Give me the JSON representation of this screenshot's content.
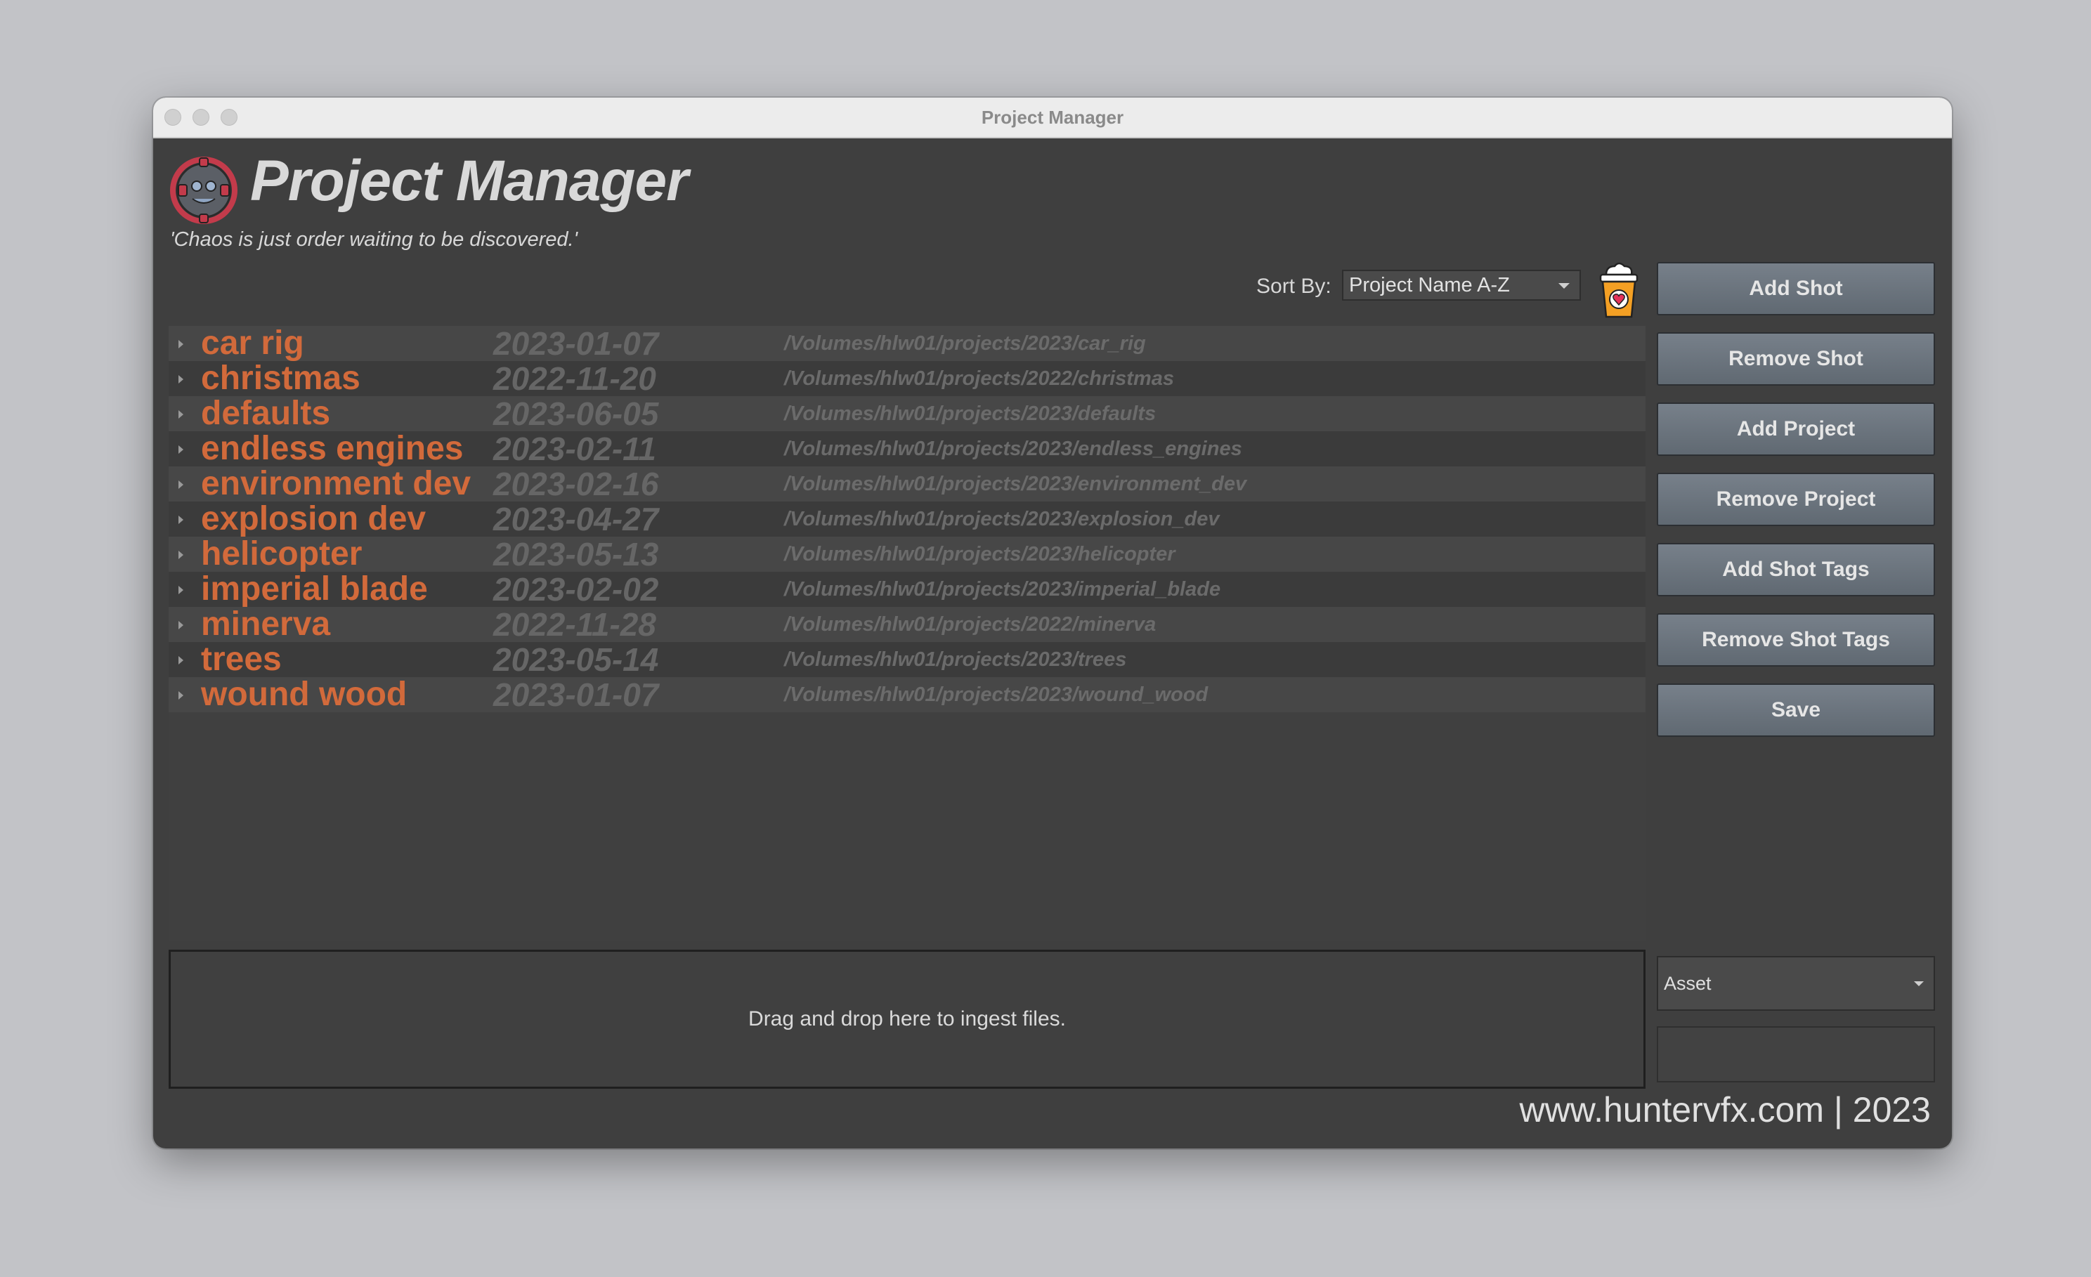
{
  "window": {
    "title": "Project Manager"
  },
  "header": {
    "title": "Project Manager",
    "tagline": "'Chaos is just order waiting to be discovered.'"
  },
  "sort": {
    "label": "Sort By:",
    "value": "Project Name A-Z"
  },
  "projects": [
    {
      "name": "car rig",
      "date": "2023-01-07",
      "path": "/Volumes/hlw01/projects/2023/car_rig"
    },
    {
      "name": "christmas",
      "date": "2022-11-20",
      "path": "/Volumes/hlw01/projects/2022/christmas"
    },
    {
      "name": "defaults",
      "date": "2023-06-05",
      "path": "/Volumes/hlw01/projects/2023/defaults"
    },
    {
      "name": "endless engines",
      "date": "2023-02-11",
      "path": "/Volumes/hlw01/projects/2023/endless_engines"
    },
    {
      "name": "environment dev",
      "date": "2023-02-16",
      "path": "/Volumes/hlw01/projects/2023/environment_dev"
    },
    {
      "name": "explosion dev",
      "date": "2023-04-27",
      "path": "/Volumes/hlw01/projects/2023/explosion_dev"
    },
    {
      "name": "helicopter",
      "date": "2023-05-13",
      "path": "/Volumes/hlw01/projects/2023/helicopter"
    },
    {
      "name": "imperial blade",
      "date": "2023-02-02",
      "path": "/Volumes/hlw01/projects/2023/imperial_blade"
    },
    {
      "name": "minerva",
      "date": "2022-11-28",
      "path": "/Volumes/hlw01/projects/2022/minerva"
    },
    {
      "name": "trees",
      "date": "2023-05-14",
      "path": "/Volumes/hlw01/projects/2023/trees"
    },
    {
      "name": "wound wood",
      "date": "2023-01-07",
      "path": "/Volumes/hlw01/projects/2023/wound_wood"
    }
  ],
  "buttons": {
    "add_shot": "Add Shot",
    "remove_shot": "Remove Shot",
    "add_project": "Add Project",
    "remove_project": "Remove Project",
    "add_shot_tags": "Add Shot Tags",
    "remove_shot_tags": "Remove Shot Tags",
    "save": "Save"
  },
  "dropzone": {
    "text": "Drag and drop here to ingest files."
  },
  "asset": {
    "value": "Asset"
  },
  "footer": {
    "text": "www.huntervfx.com | 2023"
  },
  "colors": {
    "accent": "#d26a3b",
    "background": "#3f3f3f",
    "button": "#6a737c"
  }
}
